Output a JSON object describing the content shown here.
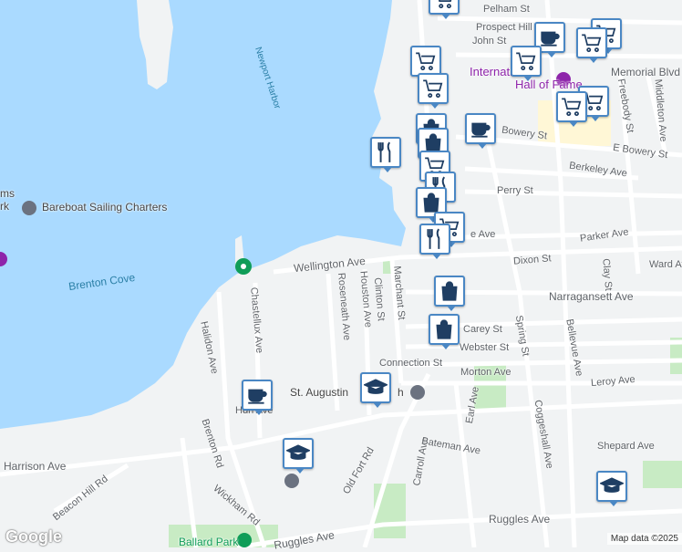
{
  "map": {
    "streets": [
      "Pelham St",
      "Prospect Hill",
      "John St",
      "Memorial Blvd",
      "Bowery St",
      "E Bowery St",
      "Berkeley Ave",
      "Perry St",
      "Parker Ave",
      "Dixon St",
      "Ward Av",
      "Narragansett Ave",
      "Wellington Ave",
      "Carey St",
      "Webster St",
      "Connection St",
      "Morton Ave",
      "Leroy Ave",
      "Spring St",
      "Coggeshall Ave",
      "Bellevue Ave",
      "Freebody St",
      "Middleton Ave",
      "Clay St",
      "Marchant St",
      "Clinton St",
      "Houston Ave",
      "Roseneath Ave",
      "Chastellux Ave",
      "Halidon Ave",
      "Harrison Ave",
      "Brenton Rd",
      "Wickham Rd",
      "Beacon Hill Rd",
      "Old Fort Rd",
      "Carroll Ave",
      "Bateman Ave",
      "Earl Ave",
      "Shepard Ave",
      "Ruggles Ave",
      "Ruggles Ave",
      "Harrison Ave"
    ],
    "water_labels": [
      "Newport Harbor",
      "Brenton Cove"
    ],
    "purple_label_line1": "International",
    "purple_label_line2": "Hall of Fame",
    "poi_bareboat": "Bareboat Sailing Charters",
    "poi_church": "St. Augustin",
    "poi_church_suffix": "h",
    "poi_ballard": "Ballard Park",
    "left_edge_label": "ms",
    "left_edge_label2": "rk",
    "halidon_partial": "Ha",
    "harrison_partial": "on Ave",
    "narragansett_partial": "nsett Ave",
    "ves_partial": "e Ave",
    "wellington_partial": "e Ave",
    "spring_partial": "Spring St",
    "bowery_partial": "ue Ave",
    "attribution": "Map data ©2025",
    "logo": "Google",
    "marker_icons": [
      "shopping-cart-icon",
      "coffee-cup-icon",
      "fork-knife-icon",
      "shopping-bag-icon",
      "graduation-cap-icon"
    ],
    "colors": {
      "water": "#aadaff",
      "land": "#f1f3f4",
      "park": "#c8ebc4",
      "marker_border": "#4a87c4",
      "marker_icon": "#1f3e63",
      "purple": "#8e24aa",
      "green_poi": "#0f9d58"
    }
  }
}
